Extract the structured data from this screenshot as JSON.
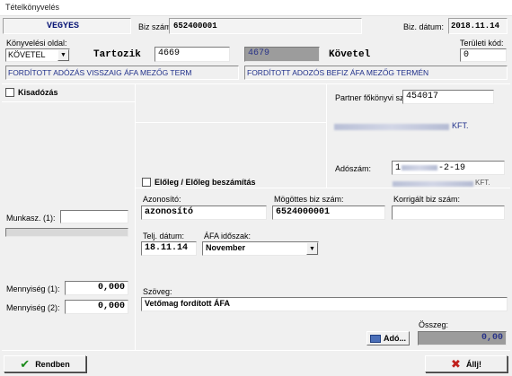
{
  "window": {
    "title": "Tételkönyvelés"
  },
  "header": {
    "type_value": "VEGYES",
    "biz_szam_label": "Biz szám:",
    "biz_szam_value": "652400001",
    "biz_datum_label": "Biz. dátum:",
    "biz_datum_value": "2018.11.14"
  },
  "booking": {
    "side_label": "Könyvelési oldal:",
    "side_value": "KÖVETEL",
    "tartozik_label": "Tartozik",
    "tartozik_value": "4669",
    "kovetel_field_value": "4679",
    "kovetel_label": "Követel",
    "teruleti_kod_label": "Területi kód:",
    "teruleti_kod_value": "0",
    "tartozik_desc": "FORDÍTOTT ADÓZÁS VISSZAIG ÁFA MEZŐG TERM",
    "kovetel_desc": "FORDÍTOTT ADOZÓS  BEFIZ ÁFA MEZŐG TERMÉN"
  },
  "left": {
    "kisadozas_label": "Kisadózás",
    "munkasz_label": "Munkasz. (1):",
    "munkasz_value": "",
    "mennyiseg1_label": "Mennyiség (1):",
    "mennyiseg1_value": "0,000",
    "mennyiseg2_label": "Mennyiség (2):",
    "mennyiseg2_value": "0,000"
  },
  "partner": {
    "fokonyv_label": "Partner főkönyvi száma:",
    "fokonyv_value": "454017",
    "name_suffix": "KFT.",
    "adoszam_label": "Adószám:",
    "adoszam_prefix": "1",
    "adoszam_suffix": "-2-19",
    "adoszam_name_suffix": "KFT."
  },
  "eloleg": {
    "label": "Előleg / Előleg beszámítás"
  },
  "ids": {
    "azonosito_label": "Azonosító:",
    "azonosito_value": "azonosító",
    "mogottes_label": "Mögöttes biz szám:",
    "mogottes_value": "6524000001",
    "korrigalt_label": "Korrigált biz szám:",
    "korrigalt_value": ""
  },
  "dates": {
    "telj_label": "Telj. dátum:",
    "telj_value": "18.11.14",
    "afa_label": "ÁFA időszak:",
    "afa_value": "November"
  },
  "szoveg": {
    "label": "Szöveg:",
    "value": "Vetőmag fordított ÁFA"
  },
  "osszeg": {
    "label": "Összeg:",
    "ado_button": "Adó...",
    "value": "0,00"
  },
  "footer": {
    "ok_button": "Rendben",
    "cancel_button": "Állj!"
  },
  "colors": {
    "accent_blue": "#1f2f8a",
    "check_green": "#1a8a1a",
    "cancel_red": "#c0201c"
  }
}
